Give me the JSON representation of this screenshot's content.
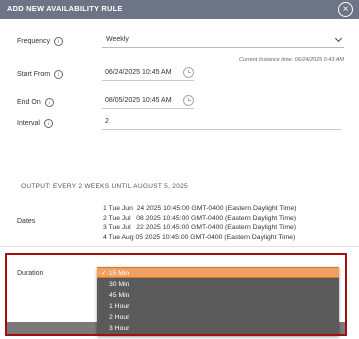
{
  "header": {
    "title": "ADD NEW AVAILABILITY RULE",
    "close_icon": "close-icon"
  },
  "form": {
    "frequency": {
      "label": "Frequency",
      "value": "Weekly"
    },
    "hint": "Current Instance time: 06/24/2025 6:43 AM",
    "start_from": {
      "label": "Start From",
      "value": "06/24/2025 10:45 AM"
    },
    "end_on": {
      "label": "End On",
      "value": "08/05/2025 10:45 AM"
    },
    "interval": {
      "label": "Interval",
      "value": "2"
    }
  },
  "output": "OUTPUT: EVERY 2 WEEKS UNTIL AUGUST 5, 2025",
  "dates": {
    "label": "Dates",
    "items": [
      "1 Tue Jun  24 2025 10:45:00 GMT-0400 (Eastern Daylight Time)",
      "2 Tue Jul   08 2025 10:45:00 GMT-0400 (Eastern Daylight Time)",
      "3 Tue Jul   22 2025 10:45:00 GMT-0400 (Eastern Daylight Time)",
      "4 Tue Aug 05 2025 10:45:00 GMT-0400 (Eastern Daylight Time)"
    ]
  },
  "duration": {
    "label": "Duration",
    "check_mark": "✓",
    "options": [
      "15 Min",
      "30 Min",
      "45 Min",
      "1 Hour",
      "2 Hour",
      "3 Hour"
    ],
    "selected_index": 0
  },
  "colors": {
    "titlebar": "#6d7486",
    "highlight_border": "#a01010",
    "dropdown_bg": "#5a5a5a",
    "selected_option": "#f0a060"
  }
}
